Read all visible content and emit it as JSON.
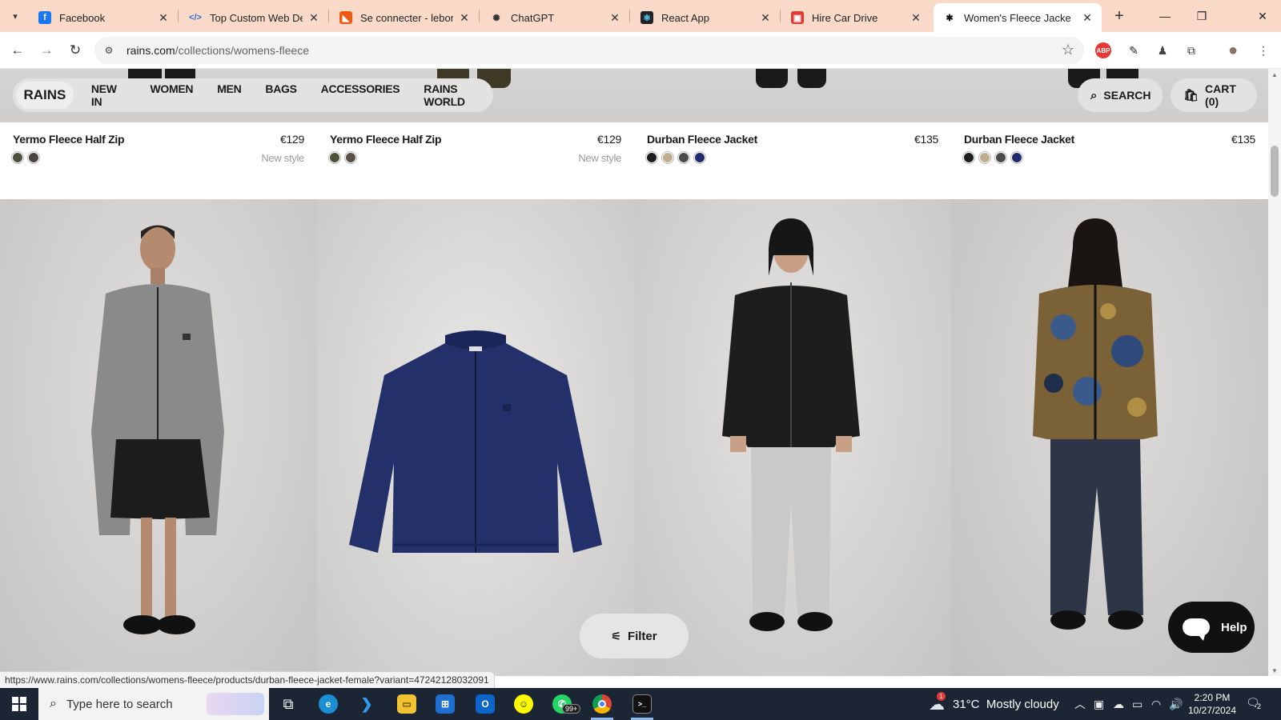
{
  "browser": {
    "tabs": [
      {
        "title": "Facebook",
        "icon": "facebook-icon",
        "icon_glyph": "f",
        "icon_bg": "#1877f2",
        "icon_fg": "#fff"
      },
      {
        "title": "Top Custom Web Deve",
        "icon": "code-icon",
        "icon_glyph": "</>",
        "icon_bg": "transparent",
        "icon_fg": "#3367d6"
      },
      {
        "title": "Se connecter - leboncc",
        "icon": "leboncoin-icon",
        "icon_glyph": "◣",
        "icon_bg": "#ec5a13",
        "icon_fg": "#fff"
      },
      {
        "title": "ChatGPT",
        "icon": "chatgpt-icon",
        "icon_glyph": "✺",
        "icon_bg": "transparent",
        "icon_fg": "#333"
      },
      {
        "title": "React App",
        "icon": "react-icon",
        "icon_glyph": "⚛",
        "icon_bg": "#20232a",
        "icon_fg": "#61dafb"
      },
      {
        "title": "Hire Car Drive",
        "icon": "car-drive-icon",
        "icon_glyph": "▣",
        "icon_bg": "#e53935",
        "icon_fg": "#fff"
      },
      {
        "title": "Women's Fleece Jacke",
        "icon": "rains-icon",
        "icon_glyph": "✱",
        "icon_bg": "transparent",
        "icon_fg": "#111",
        "active": true
      }
    ],
    "new_tab": "+",
    "window_controls": {
      "minimize": "—",
      "restore": "❐",
      "close": "✕"
    },
    "url_host": "rains.com",
    "url_path": "/collections/womens-fleece",
    "status_url": "https://www.rains.com/collections/womens-fleece/products/durban-fleece-jacket-female?variant=47242128032091",
    "extensions": [
      {
        "name": "adblock-plus-icon",
        "glyph": "ABP",
        "color": "#e53935"
      },
      {
        "name": "color-picker-icon",
        "glyph": "✎",
        "color": "#222"
      },
      {
        "name": "profile-agent-icon",
        "glyph": "♟",
        "color": "#444"
      },
      {
        "name": "puzzle-extensions-icon",
        "glyph": "⧉",
        "color": "#333"
      },
      {
        "name": "user-avatar-icon",
        "glyph": "●",
        "color": "#8d6e63"
      },
      {
        "name": "more-menu-icon",
        "glyph": "⋮",
        "color": "#333"
      }
    ]
  },
  "site": {
    "logo": "RAINS",
    "nav": [
      "NEW IN",
      "WOMEN",
      "MEN",
      "BAGS",
      "ACCESSORIES",
      "RAINS WORLD"
    ],
    "search_label": "SEARCH",
    "cart_label": "CART (0)"
  },
  "products_row": [
    {
      "name": "Yermo Fleece Half Zip",
      "price": "€129",
      "badge": "New style",
      "swatches": [
        "#4f4f3e",
        "#4a4440"
      ]
    },
    {
      "name": "Yermo Fleece Half Zip",
      "price": "€129",
      "badge": "New style",
      "swatches": [
        "#4c5238",
        "#5a5048"
      ]
    },
    {
      "name": "Durban Fleece Jacket",
      "price": "€135",
      "badge": "",
      "swatches": [
        "#1e1e1e",
        "#bfae8e",
        "#4a4a4a",
        "#1f2a6b"
      ]
    },
    {
      "name": "Durban Fleece Jacket",
      "price": "€135",
      "badge": "",
      "swatches": [
        "#1e1e1e",
        "#bfae8e",
        "#4a4a4a",
        "#1f2a6b"
      ]
    }
  ],
  "gallery": [
    {
      "image": "grey-fleece-jacket-model"
    },
    {
      "image": "navy-fleece-jacket-flat"
    },
    {
      "image": "black-fleece-jacket-model"
    },
    {
      "image": "camo-fleece-jacket-model"
    }
  ],
  "filter_label": "Filter",
  "help_label": "Help",
  "taskbar": {
    "search_placeholder": "Type here to search",
    "weather": "31°C  Mostly cloudy",
    "weather_alert": "1",
    "time": "2:20 PM",
    "date": "10/27/2024",
    "notifications": "2",
    "badge": "99+"
  }
}
